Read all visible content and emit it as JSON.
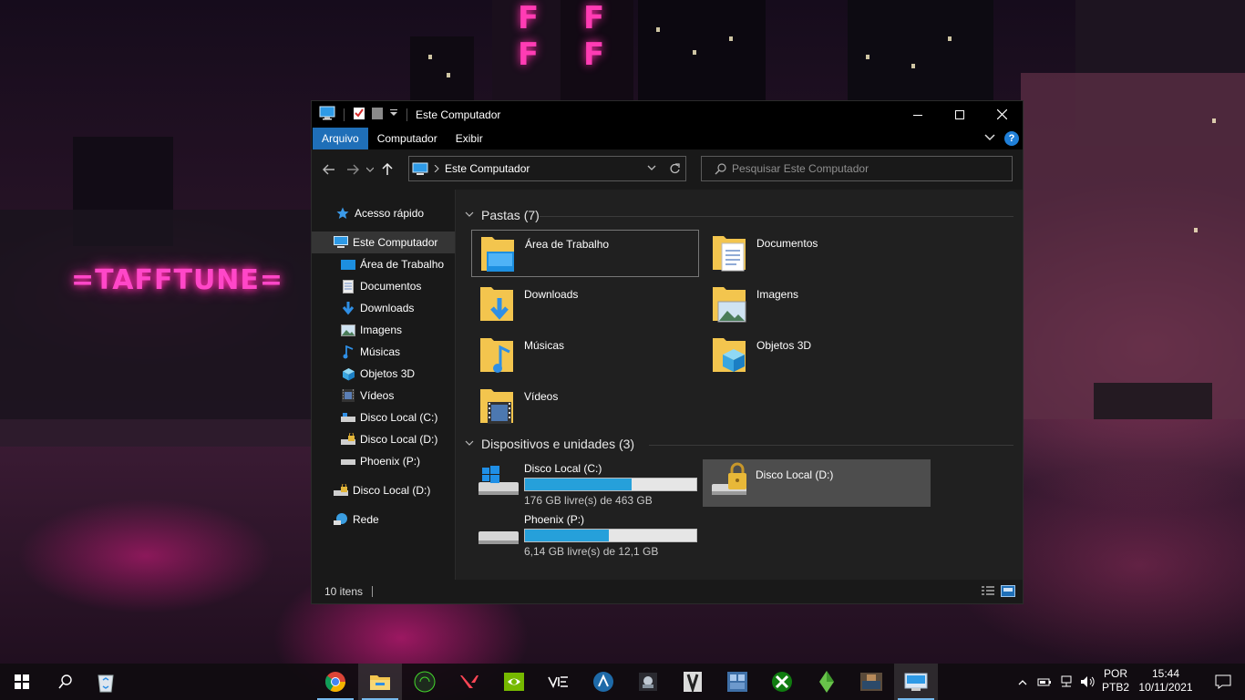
{
  "wallpaper": {
    "sign_text": "=TAFFTUNE="
  },
  "window": {
    "title": "Este Computador",
    "ribbon_tabs": [
      "Arquivo",
      "Computador",
      "Exibir"
    ],
    "help": "?",
    "address": "Este Computador",
    "search_placeholder": "Pesquisar Este Computador"
  },
  "nav": {
    "quick_access": "Acesso rápido",
    "this_pc": "Este Computador",
    "children": [
      {
        "label": "Área de Trabalho",
        "icon": "desktop-icon"
      },
      {
        "label": "Documentos",
        "icon": "document-icon"
      },
      {
        "label": "Downloads",
        "icon": "download-icon"
      },
      {
        "label": "Imagens",
        "icon": "picture-icon"
      },
      {
        "label": "Músicas",
        "icon": "music-icon"
      },
      {
        "label": "Objetos 3D",
        "icon": "cube-icon"
      },
      {
        "label": "Vídeos",
        "icon": "video-icon"
      },
      {
        "label": "Disco Local (C:)",
        "icon": "drive-icon"
      },
      {
        "label": "Disco Local (D:)",
        "icon": "locked-drive-icon"
      },
      {
        "label": "Phoenix (P:)",
        "icon": "drive-icon"
      }
    ],
    "disk_d": "Disco Local (D:)",
    "network": "Rede"
  },
  "content": {
    "folders_header": "Pastas (7)",
    "folders": [
      {
        "label": "Área de Trabalho",
        "icon": "desktop-folder-icon"
      },
      {
        "label": "Documentos",
        "icon": "documents-folder-icon"
      },
      {
        "label": "Downloads",
        "icon": "downloads-folder-icon"
      },
      {
        "label": "Imagens",
        "icon": "pictures-folder-icon"
      },
      {
        "label": "Músicas",
        "icon": "music-folder-icon"
      },
      {
        "label": "Objetos 3D",
        "icon": "objects-3d-folder-icon"
      },
      {
        "label": "Vídeos",
        "icon": "videos-folder-icon"
      }
    ],
    "devices_header": "Dispositivos e unidades (3)",
    "drives": [
      {
        "label": "Disco Local (C:)",
        "free_text": "176 GB livre(s) de 463 GB",
        "used_fraction": 0.62
      },
      {
        "label": "Disco Local (D:)",
        "locked": true
      },
      {
        "label": "Phoenix (P:)",
        "free_text": "6,14 GB livre(s) de 12,1 GB",
        "used_fraction": 0.49
      }
    ]
  },
  "status": {
    "items": "10 itens"
  },
  "taskbar": {
    "apps": [
      "chrome-icon",
      "file-explorer-icon",
      "razer-icon",
      "valorant-icon",
      "nvidia-icon",
      "rainbow-six-icon",
      "aurora-icon",
      "steam-icon",
      "game-icon",
      "gs-icon",
      "xbox-icon",
      "sims-icon",
      "game-thumbnail-icon",
      "this-pc-icon"
    ],
    "lang1": "POR",
    "lang2": "PTB2",
    "time": "15:44",
    "date": "10/11/2021"
  },
  "colors": {
    "accent": "#1f6fb8",
    "bar": "#26a0da",
    "folder": "#f3c54e"
  }
}
